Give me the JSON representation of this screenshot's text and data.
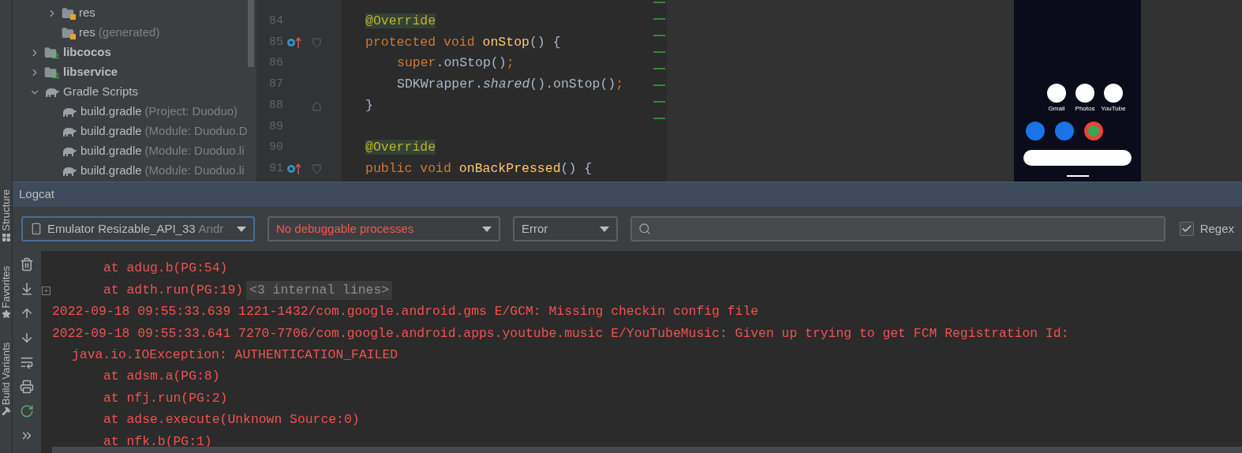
{
  "project_tree": [
    {
      "children": [
        {
          "label": "res",
          "kind": "res-folder",
          "expanded": false,
          "bold": false
        },
        {
          "label": "res",
          "note": "(generated)",
          "kind": "res-folder",
          "bold": false
        }
      ]
    },
    {
      "label": "libcocos",
      "kind": "module",
      "expanded": false,
      "bold": true
    },
    {
      "label": "libservice",
      "kind": "module",
      "expanded": false,
      "bold": true
    },
    {
      "label": "Gradle Scripts",
      "kind": "gradle",
      "expanded": true,
      "bold": false,
      "children": [
        {
          "label": "build.gradle",
          "note": "(Project: Duoduo)",
          "kind": "gradle",
          "bold": false
        },
        {
          "label": "build.gradle",
          "note": "(Module: Duoduo.D",
          "kind": "gradle",
          "bold": false
        },
        {
          "label": "build.gradle",
          "note": "(Module: Duoduo.li",
          "kind": "gradle",
          "bold": false
        },
        {
          "label": "build.gradle",
          "note": "(Module: Duoduo.li",
          "kind": "gradle",
          "bold": false
        }
      ]
    }
  ],
  "editor": {
    "lines": [
      {
        "number": "84",
        "kind": "member",
        "segments": [
          {
            "kind": "annotation",
            "text": "@Override"
          }
        ]
      },
      {
        "number": "85",
        "kind": "member",
        "override_marker": true,
        "fold_start": true,
        "segments": [
          {
            "kind": "keyword",
            "text": "protected void "
          },
          {
            "kind": "method",
            "text": "onStop"
          },
          {
            "kind": "plain",
            "text": "() {"
          }
        ]
      },
      {
        "number": "86",
        "kind": "body",
        "segments": [
          {
            "kind": "keyword",
            "text": "super"
          },
          {
            "kind": "plain",
            "text": ".onStop()"
          },
          {
            "kind": "keyword",
            "text": ";"
          }
        ]
      },
      {
        "number": "87",
        "kind": "body",
        "segments": [
          {
            "kind": "plain",
            "text": "SDKWrapper."
          },
          {
            "kind": "italic",
            "text": "shared"
          },
          {
            "kind": "plain",
            "text": "().onStop()"
          },
          {
            "kind": "keyword",
            "text": ";"
          }
        ]
      },
      {
        "number": "88",
        "kind": "member",
        "fold_end": true,
        "segments": [
          {
            "kind": "plain",
            "text": "}"
          }
        ]
      },
      {
        "number": "89"
      },
      {
        "number": "90",
        "kind": "member",
        "segments": [
          {
            "kind": "annotation",
            "text": "@Override"
          }
        ]
      },
      {
        "number": "91",
        "kind": "member",
        "override_marker": true,
        "fold_start": true,
        "segments": [
          {
            "kind": "keyword",
            "text": "public void "
          },
          {
            "kind": "method",
            "text": "onBackPressed"
          },
          {
            "kind": "plain",
            "text": "() {"
          }
        ]
      }
    ]
  },
  "emulator": {
    "app_labels": [
      "Gmail",
      "Photos",
      "YouTube"
    ]
  },
  "logcat": {
    "title": "Logcat",
    "device_dropdown": {
      "value": "Emulator Resizable_API_33",
      "suffix": "Andr",
      "focused": true,
      "error": false
    },
    "process_dropdown": {
      "value": "No debuggable processes",
      "focused": false,
      "error": true
    },
    "level_dropdown": {
      "value": "Error",
      "focused": false,
      "error": false
    },
    "regex": {
      "label": "Regex",
      "checked": true
    },
    "side_tabs": [
      "Structure",
      "Favorites",
      "Build Variants"
    ],
    "lines": [
      {
        "kind": "frame",
        "text": "at adug.b(PG:54)"
      },
      {
        "kind": "frame",
        "text": "at adth.run(PG:19)",
        "folded": "<3 internal lines>"
      },
      {
        "kind": "entry",
        "text": "2022-09-18 09:55:33.639 1221-1432/com.google.android.gms E/GCM: Missing checkin config file"
      },
      {
        "kind": "entry",
        "text": "2022-09-18 09:55:33.641 7270-7706/com.google.android.apps.youtube.music E/YouTubeMusic: Given up trying to get FCM Registration Id:"
      },
      {
        "kind": "exception",
        "text": "java.io.IOException: AUTHENTICATION_FAILED"
      },
      {
        "kind": "frame",
        "text": "at adsm.a(PG:8)"
      },
      {
        "kind": "frame",
        "text": "at nfj.run(PG:2)"
      },
      {
        "kind": "frame",
        "text": "at adse.execute(Unknown Source:0)"
      },
      {
        "kind": "frame",
        "text": "at nfk.b(PG:1)"
      }
    ]
  }
}
